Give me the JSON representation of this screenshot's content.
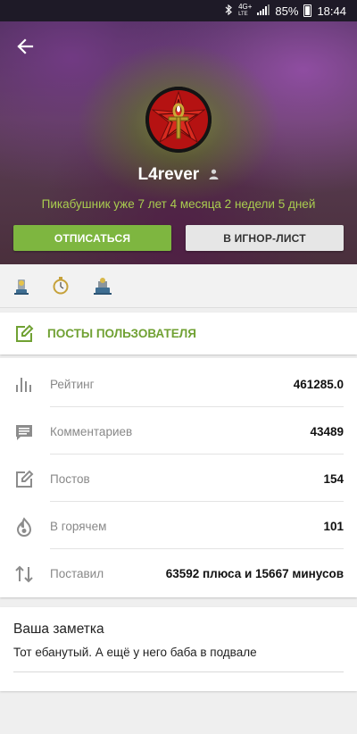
{
  "status_bar": {
    "bluetooth_icon": "bluetooth-icon",
    "network_top": "4G+",
    "network_bottom": "LTE",
    "signal_icon": "signal-icon",
    "battery": "85%",
    "time": "18:44"
  },
  "header": {
    "back_icon": "arrow-left-icon",
    "username": "L4rever",
    "user_icon": "person-icon",
    "since": "Пикабушник уже 7 лет 4 месяца 2 недели 5 дней",
    "unsubscribe_label": "ОТПИСАТЬСЯ",
    "ignore_label": "В ИГНОР-ЛИСТ",
    "accent": "#7eb640"
  },
  "awards": [
    "award-medal-icon",
    "award-stopwatch-icon",
    "award-trophy-icon"
  ],
  "posts": {
    "icon": "edit-icon",
    "label": "ПОСТЫ ПОЛЬЗОВАТЕЛЯ"
  },
  "stats": [
    {
      "icon": "bar-chart-icon",
      "label": "Рейтинг",
      "value": "461285.0"
    },
    {
      "icon": "comment-icon",
      "label": "Комментариев",
      "value": "43489"
    },
    {
      "icon": "edit-icon",
      "label": "Постов",
      "value": "154"
    },
    {
      "icon": "flame-icon",
      "label": "В горячем",
      "value": "101"
    },
    {
      "icon": "updown-arrows-icon",
      "label": "Поставил",
      "value": "63592 плюса и 15667 минусов"
    }
  ],
  "note": {
    "title": "Ваша заметка",
    "text": "Тот ебанутый. А ещё у него баба в подвале"
  }
}
